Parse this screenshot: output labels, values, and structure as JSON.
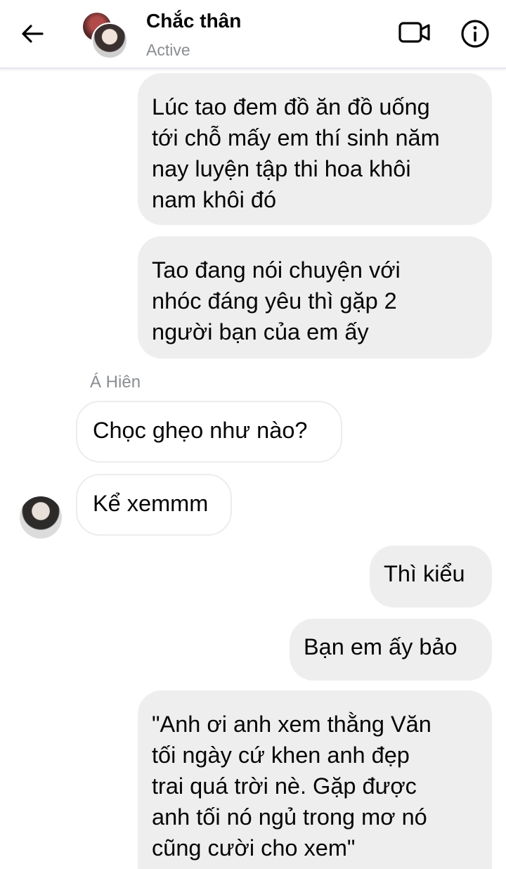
{
  "header": {
    "contact_name": "Chắc thân",
    "status": "Active",
    "back_icon": "arrow-left-icon",
    "video_icon": "video-camera-icon",
    "info_icon": "info-icon"
  },
  "messages": [
    {
      "direction": "outgoing",
      "text": "Lúc tao đem đồ ăn đồ uống\ntới chỗ mấy em thí sinh năm\nnay luyện tập thi hoa khôi\nnam khôi đó"
    },
    {
      "direction": "outgoing",
      "text": "Tao đang nói chuyện với\nnhóc đáng yêu thì gặp 2\nngười bạn của em ấy"
    },
    {
      "direction": "incoming",
      "sender": "Á Hiên",
      "text": "Chọc ghẹo như nào?"
    },
    {
      "direction": "incoming",
      "text": "Kể xemmm"
    },
    {
      "direction": "outgoing",
      "text": "Thì kiểu"
    },
    {
      "direction": "outgoing",
      "text": "Bạn em ấy bảo"
    },
    {
      "direction": "outgoing",
      "text": "\"Anh ơi anh xem thằng Văn\ntối ngày cứ khen anh đẹp\ntrai quá trời nè. Gặp được\nanh tối nó ngủ trong mơ nó\ncũng cười cho xem\""
    }
  ],
  "colors": {
    "outgoing_bubble": "#eeeeee",
    "incoming_border": "#ebeced",
    "secondary_text": "#8a8d91"
  }
}
